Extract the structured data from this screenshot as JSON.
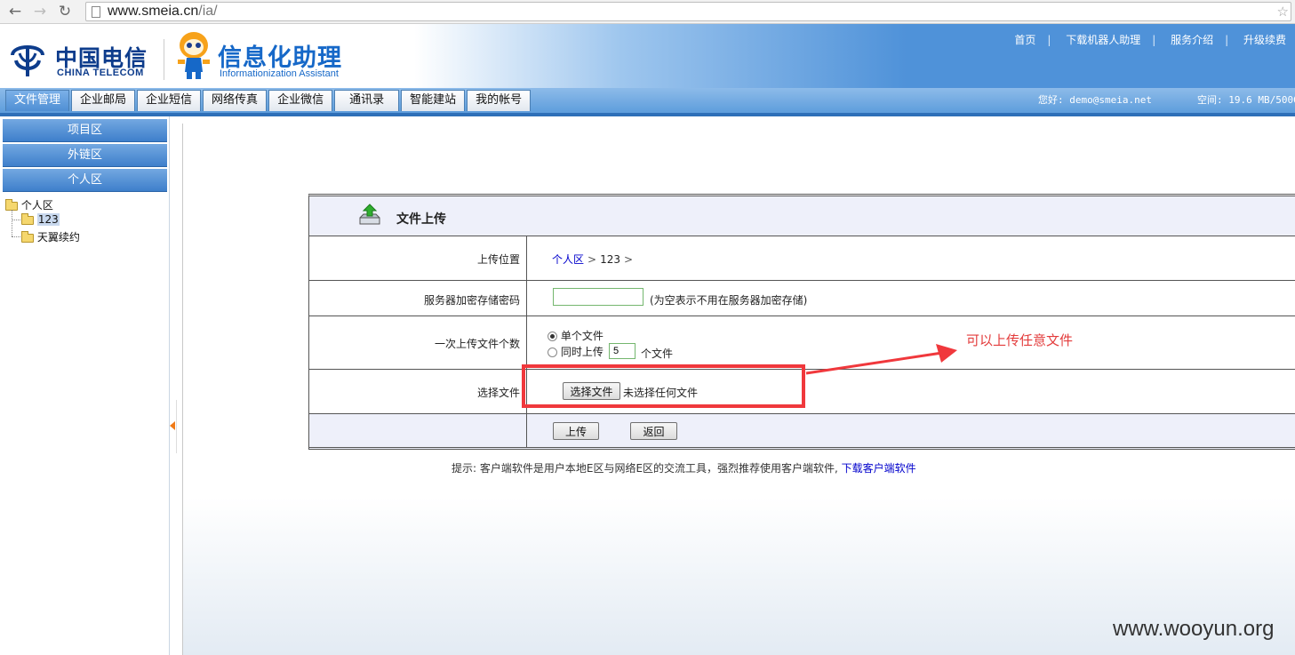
{
  "browser": {
    "url_domain": "www.smeia.cn",
    "url_path": "/ia/"
  },
  "header": {
    "brand_cn": "中国电信",
    "brand_en": "CHINA TELECOM",
    "product_cn": "信息化助理",
    "product_en": "Informationization Assistant",
    "top_links": [
      "首页",
      "下载机器人助理",
      "服务介绍",
      "升级续费"
    ],
    "greeting": "您好: demo@smeia.net",
    "space": "空间: 19.6 MB/5000"
  },
  "tabs": [
    {
      "label": "文件管理",
      "active": true
    },
    {
      "label": "企业邮局",
      "active": false
    },
    {
      "label": "企业短信",
      "active": false
    },
    {
      "label": "网络传真",
      "active": false
    },
    {
      "label": "企业微信",
      "active": false
    },
    {
      "label": "通讯录",
      "active": false
    },
    {
      "label": "智能建站",
      "active": false
    },
    {
      "label": "我的帐号",
      "active": false
    }
  ],
  "sidebar": {
    "sections": [
      "项目区",
      "外链区",
      "个人区"
    ],
    "tree_root": "个人区",
    "tree_items": [
      "123",
      "天翼续约"
    ]
  },
  "upload": {
    "title": "文件上传",
    "location_label": "上传位置",
    "location_crumbs": [
      "个人区",
      "123"
    ],
    "password_label": "服务器加密存储密码",
    "password_value": "",
    "password_hint": "(为空表示不用在服务器加密存储)",
    "count_label": "一次上传文件个数",
    "single_label": "单个文件",
    "multi_label": "同时上传",
    "multi_value": "5",
    "multi_unit": "个文件",
    "choose_label": "选择文件",
    "choose_button": "选择文件",
    "choose_status": "未选择任何文件",
    "submit_button": "上传",
    "back_button": "返回"
  },
  "tip": {
    "text": "提示: 客户端软件是用户本地E区与网络E区的交流工具，强烈推荐使用客户端软件,",
    "link": "下载客户端软件"
  },
  "annotation": {
    "text": "可以上传任意文件",
    "color": "#e33c3c"
  },
  "watermark": "www.wooyun.org"
}
